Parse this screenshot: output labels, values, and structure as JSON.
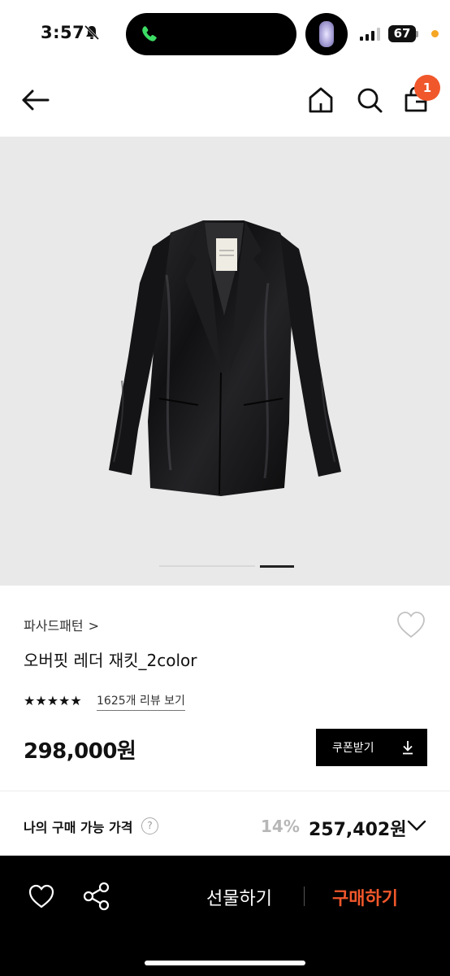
{
  "status_bar": {
    "time": "3:57",
    "battery": "67",
    "icons": [
      "bell-slash-icon",
      "phone-icon",
      "flashlight-icon",
      "signal-icon",
      "battery-icon"
    ]
  },
  "header": {
    "icons": [
      "back-arrow-icon",
      "home-icon",
      "search-icon",
      "cart-icon"
    ],
    "cart_count": "1"
  },
  "gallery": {
    "slide_count": 2,
    "active_slide": 2
  },
  "product": {
    "brand": "파사드패턴",
    "brand_chevron": ">",
    "name": "오버핏 레더 재킷_2color",
    "stars": "★★★★★",
    "rating_fraction": 1.0,
    "reviews_link": "1625개 리뷰 보기",
    "price": "298,000원",
    "coupon_button": "쿠폰받기"
  },
  "my_price": {
    "label": "나의 구매 가능 가격",
    "help_icon": "?",
    "discount_rate": "14%",
    "discount_price": "257,402원"
  },
  "bottom_bar": {
    "gift_label": "선물하기",
    "buy_label": "구매하기",
    "icons": [
      "heart-icon",
      "share-icon"
    ]
  },
  "colors": {
    "accent_orange": "#f0572b",
    "bottom_bar_bg": "#000000",
    "hero_bg": "#e9e9e9",
    "discount_gray": "#b7b7b7"
  }
}
